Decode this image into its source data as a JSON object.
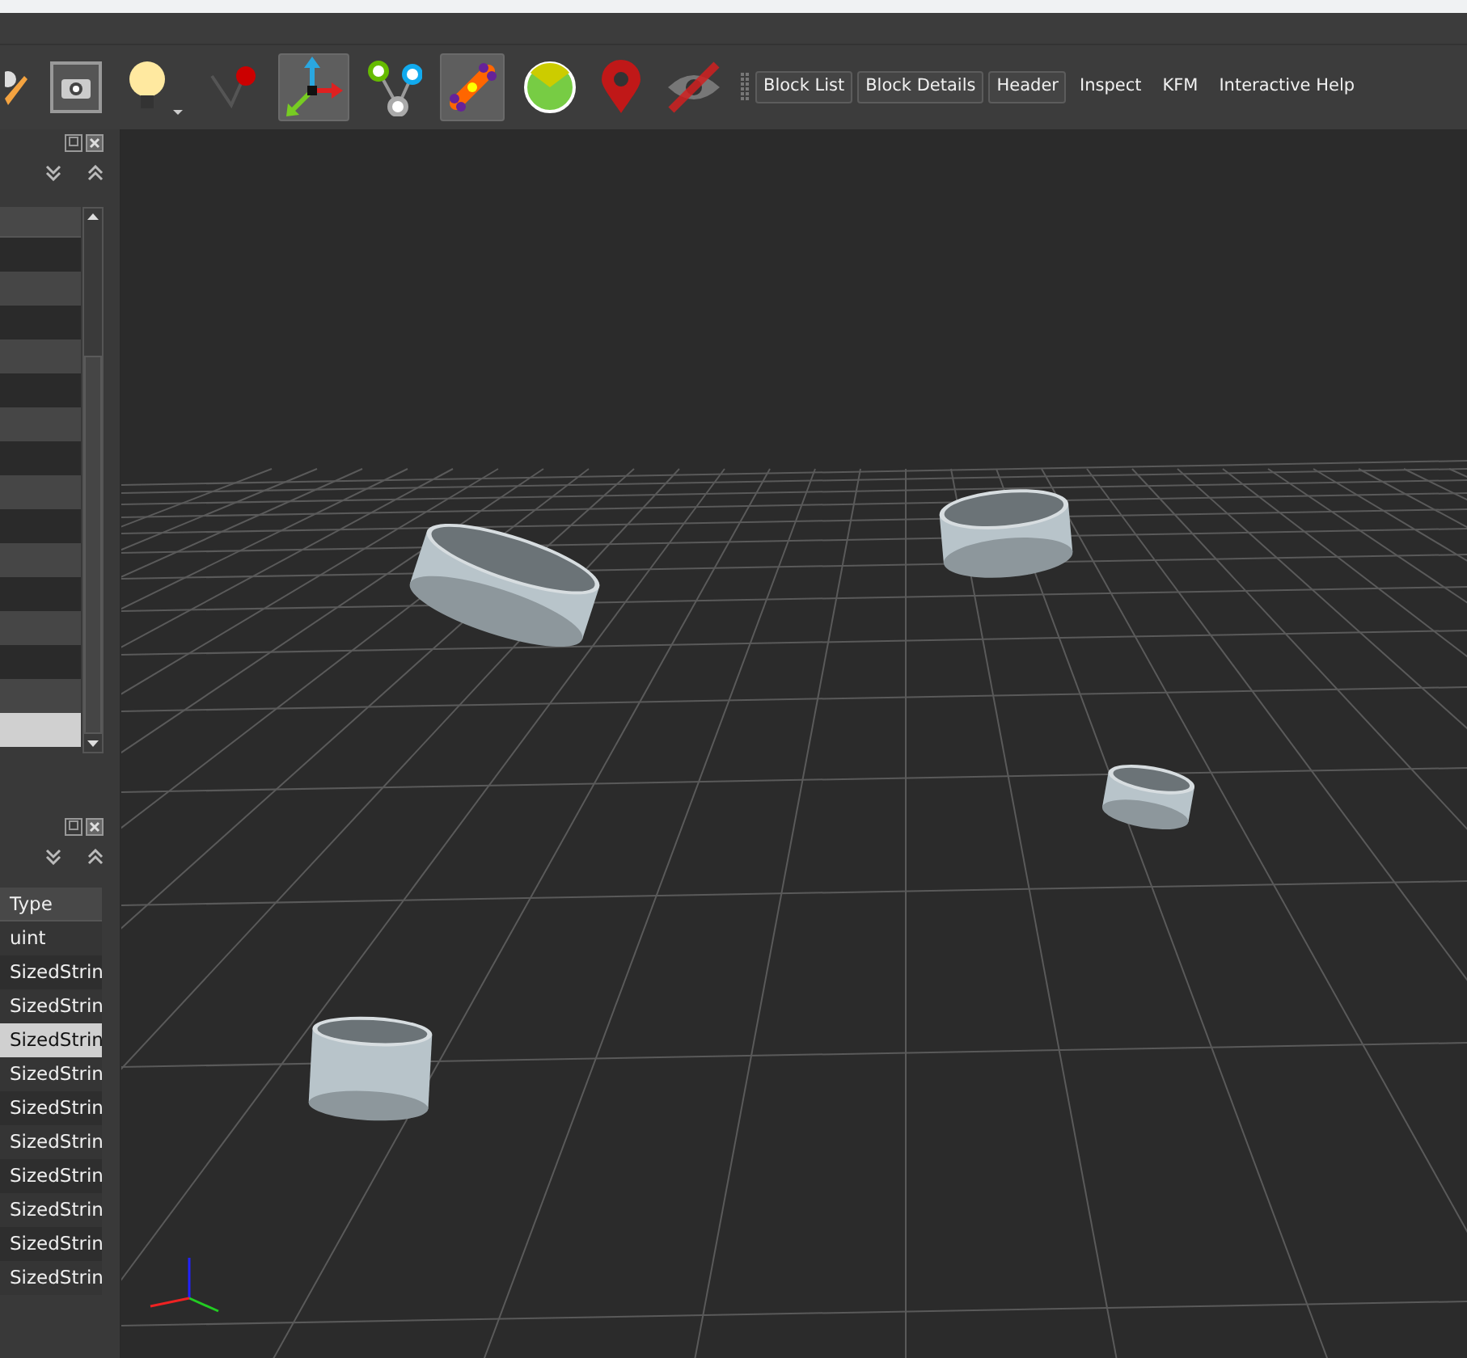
{
  "toolbar": {
    "tools": [
      {
        "kind": "pencil",
        "selected": false
      },
      {
        "kind": "camera",
        "selected": false
      },
      {
        "kind": "bulb",
        "selected": false
      },
      {
        "kind": "pin",
        "selected": false
      },
      {
        "kind": "axes",
        "selected": true
      },
      {
        "kind": "nodes",
        "selected": false
      },
      {
        "kind": "bone",
        "selected": true
      },
      {
        "kind": "gauge",
        "selected": false
      },
      {
        "kind": "marker",
        "selected": false
      },
      {
        "kind": "hidden",
        "selected": false
      }
    ],
    "toggles": [
      {
        "label": "Block List",
        "checked": true
      },
      {
        "label": "Block Details",
        "checked": true
      },
      {
        "label": "Header",
        "checked": true
      },
      {
        "label": "Inspect",
        "checked": false
      },
      {
        "label": "KFM",
        "checked": false
      },
      {
        "label": "Interactive Help",
        "checked": false
      }
    ]
  },
  "block_list": {
    "rows": [
      {
        "selected": false
      },
      {
        "selected": false
      },
      {
        "selected": false
      },
      {
        "selected": false
      },
      {
        "selected": false
      },
      {
        "selected": false
      },
      {
        "selected": false
      },
      {
        "selected": false
      },
      {
        "selected": false
      },
      {
        "selected": false
      },
      {
        "selected": false
      },
      {
        "selected": false
      },
      {
        "selected": false
      },
      {
        "selected": false
      },
      {
        "selected": true
      }
    ]
  },
  "block_details": {
    "columns": [
      "Type"
    ],
    "rows": [
      {
        "type": "uint",
        "selected": false
      },
      {
        "type": "SizedStrin",
        "selected": false
      },
      {
        "type": "SizedStrin",
        "selected": false
      },
      {
        "type": "SizedStrin",
        "selected": true
      },
      {
        "type": "SizedStrin",
        "selected": false
      },
      {
        "type": "SizedStrin",
        "selected": false
      },
      {
        "type": "SizedStrin",
        "selected": false
      },
      {
        "type": "SizedStrin",
        "selected": false
      },
      {
        "type": "SizedStrin",
        "selected": false
      },
      {
        "type": "SizedStrin",
        "selected": false
      },
      {
        "type": "SizedStrin",
        "selected": false
      }
    ]
  }
}
